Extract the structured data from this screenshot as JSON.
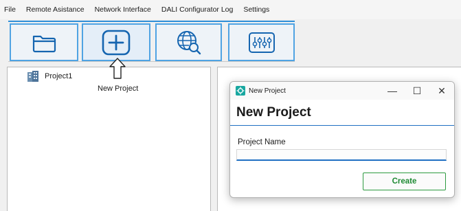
{
  "menu": {
    "items": [
      "File",
      "Remote Asistance",
      "Network Interface",
      "DALI Configurator Log",
      "Settings"
    ]
  },
  "toolbar": {
    "buttons": [
      {
        "icon": "folder-icon"
      },
      {
        "icon": "plus-icon"
      },
      {
        "icon": "globe-search-icon"
      },
      {
        "icon": "sliders-icon"
      }
    ]
  },
  "tree": {
    "items": [
      {
        "label": "Project1",
        "icon": "building-icon"
      }
    ]
  },
  "annotation": {
    "caption": "New Project",
    "icon": "hand-pointer-icon"
  },
  "dialog": {
    "title": "New Project",
    "heading": "New Project",
    "field_label": "Project Name",
    "field_value": "",
    "create_label": "Create",
    "controls": {
      "minimize": "—",
      "maximize": "☐",
      "close": "✕"
    }
  },
  "colors": {
    "accent": "#2f8fd8",
    "button_border": "#4fa3e3",
    "create_green": "#1e8a33",
    "heading_underline": "#1f6fc2"
  }
}
